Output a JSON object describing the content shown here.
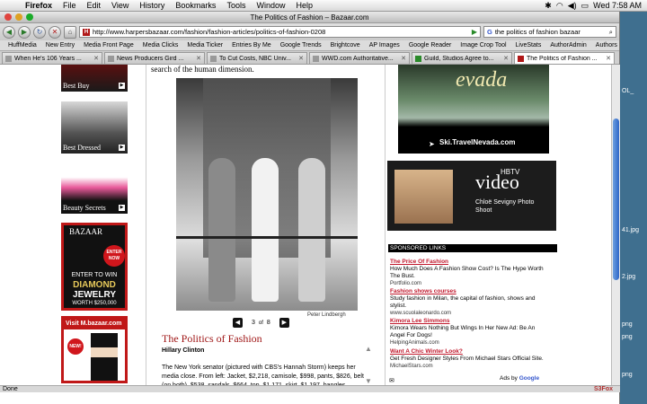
{
  "os": {
    "apple": "",
    "menus": [
      "Firefox",
      "File",
      "Edit",
      "View",
      "History",
      "Bookmarks",
      "Tools",
      "Window",
      "Help"
    ],
    "clock": "Wed 7:58 AM"
  },
  "window": {
    "title": "The Politics of Fashion – Bazaar.com",
    "url": "http://www.harpersbazaar.com/fashion/fashion-articles/politics-of-fashion-0208",
    "search_engine_glyph": "G",
    "search_query": "the politics of fashion bazaar"
  },
  "bookmarks": [
    "HuffMedia",
    "New Entry",
    "Media Front Page",
    "Media Clicks",
    "Media Ticker",
    "Entries By Me",
    "Google Trends",
    "Brightcove",
    "AP Images",
    "Google Reader",
    "Image Crop Tool",
    "LiveStats",
    "AuthorAdmin",
    "Authors"
  ],
  "tabs": [
    {
      "label": "When He's 106 Years ...",
      "active": false
    },
    {
      "label": "News Producers Gird ...",
      "active": false
    },
    {
      "label": "To Cut Costs, NBC Univ...",
      "active": false
    },
    {
      "label": "WWD.com Authoritative...",
      "active": false
    },
    {
      "label": "Guild, Studios Agree to...",
      "active": false
    },
    {
      "label": "The Politics of Fashion ...",
      "active": true
    }
  ],
  "left_ads": [
    {
      "caption": "Best Buy"
    },
    {
      "caption": "Best Dressed"
    },
    {
      "caption": "Beauty Secrets"
    }
  ],
  "bazaar_ad": {
    "brand": "BAZAAR",
    "badge": "ENTER NOW",
    "line1": "ENTER TO WIN",
    "line2": "DIAMOND",
    "line3": "JEWELRY",
    "line4": "WORTH $250,000"
  },
  "mbazaar_ad": {
    "brand": "Visit M.bazaar.com",
    "badge": "NEW!"
  },
  "article": {
    "lead": "search of the human dimension.",
    "photo_credit": "Peter Lindbergh",
    "pager_current": "3",
    "pager_sep": "of",
    "pager_total": "8",
    "title": "The Politics of Fashion",
    "byline": "Hillary Clinton",
    "body": "The New York senator (pictured with CBS's Hannah Storm) keeps her media close. From left: Jacket, $2,218, camisole, $998, pants, $826, belt (on both), $538, sandals, $664, top, $1,171, skirt, $1,197, bangles,"
  },
  "nevada_ad": {
    "word": "evada",
    "url": "Ski.TravelNevada.com"
  },
  "hbtv": {
    "label": "HBTV",
    "video": "video",
    "desc": "Chloë Sevigny Photo Shoot"
  },
  "sponsored": {
    "header": "SPONSORED LINKS",
    "links": [
      {
        "title": "The Price Of Fashion",
        "desc": "How Much Does A Fashion Show Cost? Is The Hype Worth The Bust.",
        "url": "Portfolio.com"
      },
      {
        "title": "Fashion shows courses",
        "desc": "Study fashion in Milan, the capital of fashion, shows and stylist.",
        "url": "www.scuolaleonardo.com"
      },
      {
        "title": "Kimora Lee Simmons",
        "desc": "Kimora Wears Nothing But Wings In Her New Ad: Be An Angel For Dogs!",
        "url": "HelpingAnimals.com"
      },
      {
        "title": "Want A Chic Winter Look?",
        "desc": "Get Fresh Designer Styles From Michael Stars Official Site.",
        "url": "MichaelStars.com"
      }
    ],
    "ads_by": "Ads by",
    "google": "Google"
  },
  "status": {
    "text": "Done",
    "s3fox": "S3Fox"
  },
  "desktop": {
    "files": [
      "OL_",
      "41.jpg",
      "2.jpg",
      "png",
      "png",
      "png"
    ]
  }
}
